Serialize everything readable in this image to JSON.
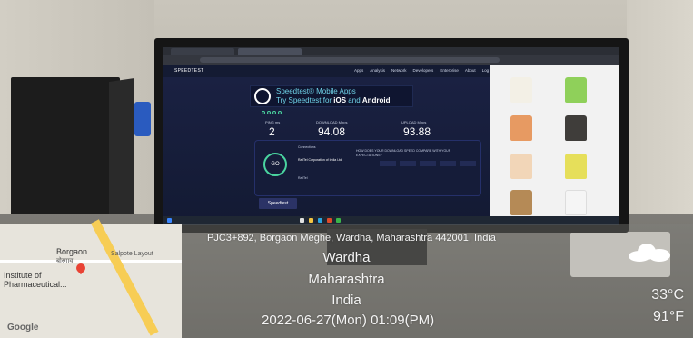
{
  "photo": {
    "screen": {
      "site_logo": "SPEEDTEST",
      "nav": [
        "Apps",
        "Analysis",
        "Network",
        "Developers",
        "Enterprise",
        "About",
        "Log In"
      ],
      "promo_line1": "Speedtest® Mobile Apps",
      "promo_line2_prefix": "Try Speedtest for ",
      "promo_line2_ios": "iOS",
      "promo_line2_and": " and ",
      "promo_line2_android": "Android",
      "ping_label": "PING ms",
      "ping_value": "2",
      "download_label": "DOWNLOAD Mbps",
      "download_value": "94.08",
      "upload_label": "UPLOAD Mbps",
      "upload_value": "93.88",
      "go_label": "GO",
      "connections_label": "Connections",
      "provider_name": "RailTel Corporation of India Ltd",
      "server_label": "RailTel",
      "question": "HOW DOES YOUR DOWNLOAD SPEED COMPARE WITH YOUR EXPECTATIONS?",
      "speed_chip": "Speedtest",
      "colors": {
        "accent_cyan": "#6fd3e8",
        "accent_green": "#4ad5a0",
        "bg": "#131a33"
      }
    },
    "map": {
      "place_name": "Borgaon",
      "place_name_local": "बोरगाव",
      "street_label": "Salpote Layout",
      "institute": "Institute of Pharmaceutical...",
      "brand": "Google"
    },
    "caption": {
      "address": "PJC3+892, Borgaon Meghe, Wardha, Maharashtra 442001, India",
      "city": "Wardha",
      "state": "Maharashtra",
      "country": "India",
      "datetime": "2022-06-27(Mon)  01:09(PM)",
      "temp_c": "33°C",
      "temp_f": "91°F",
      "weather_icon": "cloud-icon"
    }
  }
}
